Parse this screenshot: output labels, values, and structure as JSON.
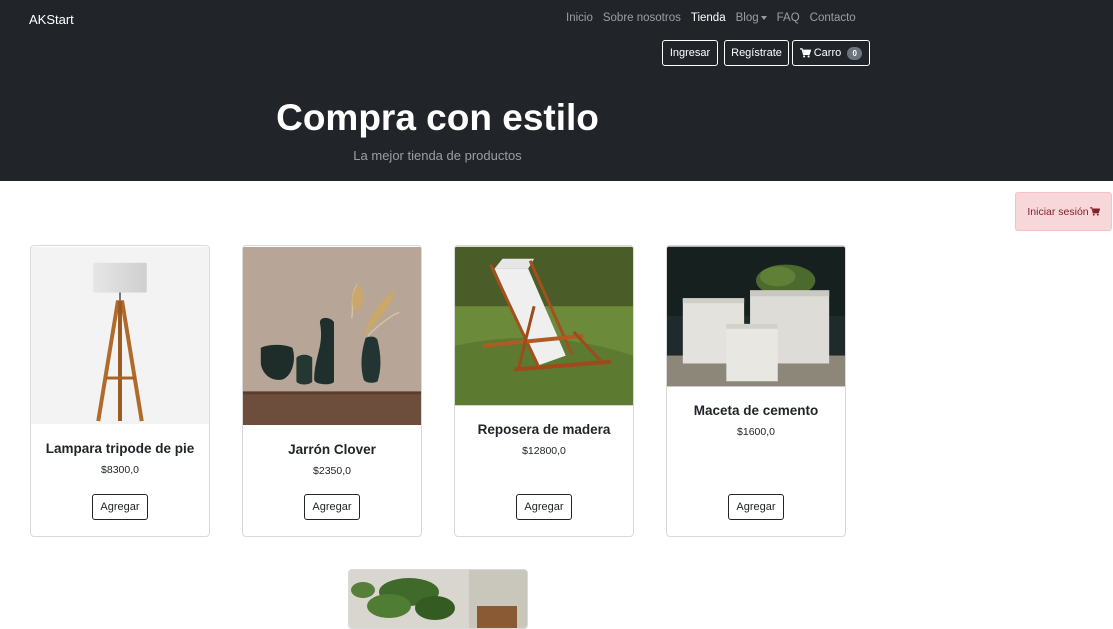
{
  "navbar": {
    "brand": "AKStart",
    "links": [
      {
        "label": "Inicio",
        "active": false
      },
      {
        "label": "Sobre nosotros",
        "active": false
      },
      {
        "label": "Tienda",
        "active": true
      },
      {
        "label": "Blog",
        "active": false,
        "dropdown": true
      },
      {
        "label": "FAQ",
        "active": false
      },
      {
        "label": "Contacto",
        "active": false
      }
    ],
    "login_label": "Ingresar",
    "register_label": "Regístrate",
    "cart_label": "Carro",
    "cart_count": "0",
    "cart_icon": "cart-icon"
  },
  "hero": {
    "title": "Compra con estilo",
    "subtitle": "La mejor tienda de productos"
  },
  "login_alert": {
    "label": "Iniciar sesión",
    "icon": "cart-icon"
  },
  "products": [
    {
      "name": "Lampara tripode de pie",
      "price": "$8300,0",
      "button": "Agregar",
      "image": "floor-lamp-image"
    },
    {
      "name": "Jarrón Clover",
      "price": "$2350,0",
      "button": "Agregar",
      "image": "vases-image"
    },
    {
      "name": "Reposera de madera",
      "price": "$12800,0",
      "button": "Agregar",
      "image": "lounge-chair-image"
    },
    {
      "name": "Maceta de cemento",
      "price": "$1600,0",
      "button": "Agregar",
      "image": "cement-planters-image"
    }
  ],
  "colors": {
    "navbar_bg": "#212529",
    "alert_bg": "#f8d7da",
    "alert_text": "#842029"
  }
}
